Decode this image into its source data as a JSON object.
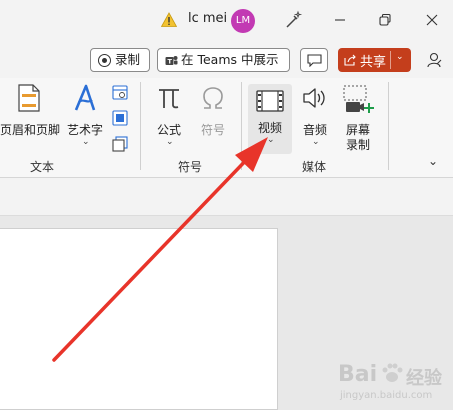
{
  "titlebar": {
    "username": "lc mei",
    "avatar_initials": "LM"
  },
  "toolbar": {
    "record_label": "录制",
    "teams_label": "在 Teams 中展示",
    "share_label": "共享"
  },
  "ribbon": {
    "groups": {
      "text": "文本",
      "symbols": "符号",
      "media": "媒体"
    },
    "buttons": {
      "header_footer": "页眉和页脚",
      "wordart": "艺术字",
      "formula": "公式",
      "symbol": "符号",
      "video": "视频",
      "audio": "音频",
      "screen_record_line1": "屏幕",
      "screen_record_line2": "录制"
    }
  },
  "watermark": {
    "brand": "Bai",
    "brand_cn": "经验",
    "url": "jingyan.baidu.com"
  },
  "colors": {
    "share_bg": "#c43e1c",
    "avatar_bg": "#c239b3",
    "arrow": "#e8342a",
    "wordart_blue": "#2b6fd6"
  }
}
